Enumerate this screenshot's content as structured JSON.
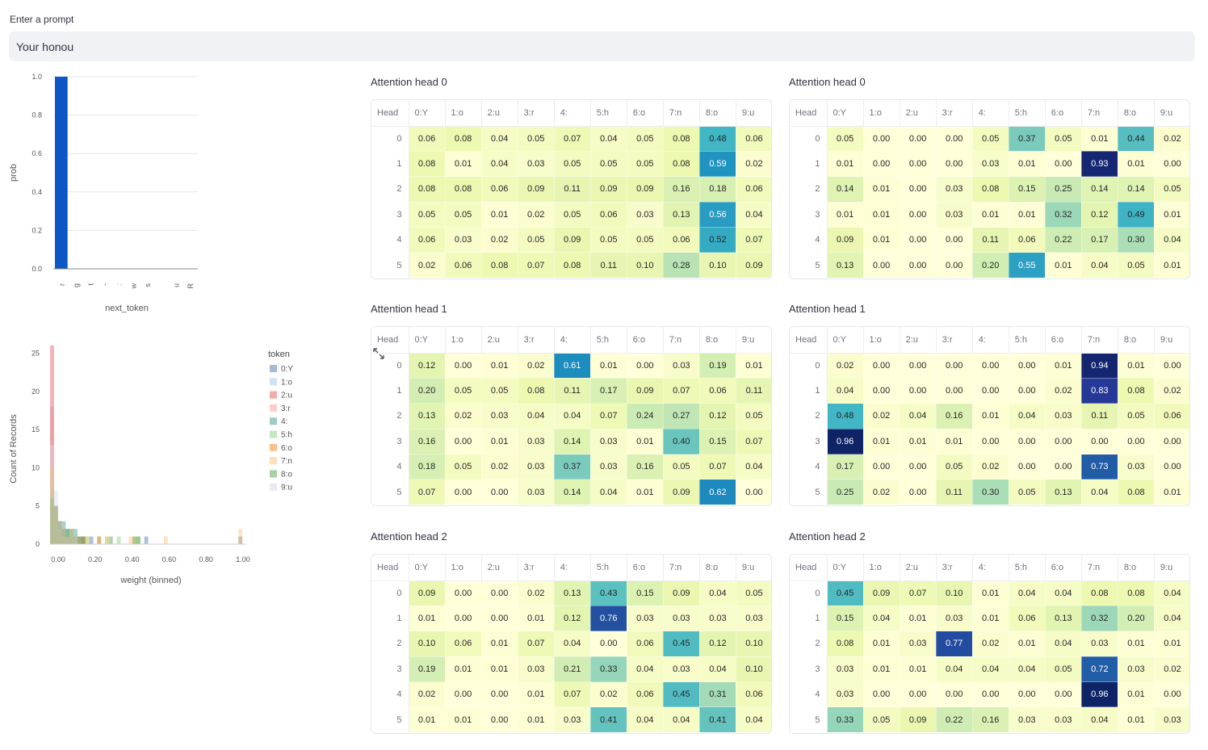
{
  "prompt": {
    "label": "Enter a prompt",
    "value": "Your honou",
    "placeholder": ""
  },
  "bar_chart": {
    "type": "bar",
    "ylabel": "prob",
    "xlabel": "next_token",
    "ylim": [
      0,
      1
    ],
    "yticks": [
      "0.0",
      "0.2",
      "0.4",
      "0.6",
      "0.8",
      "1.0"
    ],
    "categories": [
      "r",
      "g",
      "t",
      "-",
      ":",
      "w",
      "s",
      " ",
      "u",
      "R"
    ],
    "values": [
      1.0,
      0,
      0,
      0,
      0,
      0,
      0,
      0,
      0,
      0
    ],
    "color": "#0b57c6"
  },
  "hist_chart": {
    "type": "bar",
    "xlabel": "weight (binned)",
    "ylabel": "Count of Records",
    "legend_title": "token",
    "legend_placement": "right",
    "xticks": [
      "0.00",
      "0.20",
      "0.40",
      "0.60",
      "0.80",
      "1.00"
    ],
    "yticks": [
      "0",
      "5",
      "10",
      "15",
      "20",
      "25"
    ],
    "ylim": [
      0,
      26
    ],
    "tokens": [
      "0:Y",
      "1:o",
      "2:u",
      "3:r",
      "4:",
      "5:h",
      "6:o",
      "7:n",
      "8:o",
      "9:u"
    ],
    "colors": [
      "#4c78a8",
      "#9ecae9",
      "#e45756",
      "#ff9d98",
      "#439894",
      "#88d27a",
      "#f58518",
      "#ffbf79",
      "#54a24b",
      "#d6d6e6"
    ],
    "series": [
      {
        "name": "0:Y",
        "values": [
          8,
          4,
          3,
          2,
          1,
          1,
          0,
          0,
          1,
          0,
          1,
          0,
          0,
          0,
          0,
          0,
          0,
          0,
          0,
          0,
          0,
          0,
          0,
          0,
          1,
          0,
          0,
          0,
          0,
          0,
          0,
          0,
          0,
          0,
          0,
          0,
          0,
          0,
          0,
          0,
          0,
          0,
          0,
          0,
          0,
          0,
          0,
          0,
          1,
          0
        ]
      },
      {
        "name": "1:o",
        "values": [
          18,
          2,
          2,
          1,
          1,
          0,
          0,
          0,
          0,
          0,
          0,
          0,
          0,
          0,
          0,
          0,
          0,
          0,
          0,
          0,
          0,
          0,
          0,
          0,
          0,
          0,
          0,
          0,
          0,
          0,
          0,
          0,
          0,
          0,
          0,
          0,
          0,
          0,
          0,
          0,
          0,
          0,
          0,
          0,
          0,
          0,
          0,
          0,
          0,
          0
        ]
      },
      {
        "name": "2:u",
        "values": [
          26,
          3,
          1,
          0,
          0,
          0,
          0,
          0,
          0,
          0,
          0,
          0,
          0,
          0,
          0,
          0,
          0,
          0,
          0,
          0,
          0,
          0,
          0,
          0,
          0,
          0,
          0,
          0,
          0,
          0,
          0,
          0,
          0,
          0,
          0,
          0,
          0,
          0,
          0,
          0,
          0,
          0,
          0,
          0,
          0,
          0,
          0,
          0,
          0,
          0
        ]
      },
      {
        "name": "3:r",
        "values": [
          17,
          4,
          3,
          2,
          1,
          1,
          0,
          1,
          0,
          0,
          0,
          0,
          0,
          0,
          0,
          0,
          0,
          0,
          0,
          0,
          0,
          0,
          0,
          0,
          0,
          0,
          0,
          0,
          0,
          0,
          0,
          0,
          0,
          0,
          0,
          0,
          0,
          0,
          0,
          0,
          0,
          0,
          0,
          0,
          0,
          0,
          0,
          0,
          0,
          0
        ]
      },
      {
        "name": "4:",
        "values": [
          7,
          5,
          2,
          3,
          2,
          1,
          2,
          1,
          0,
          0,
          0,
          0,
          1,
          0,
          0,
          0,
          0,
          0,
          0,
          0,
          0,
          0,
          0,
          0,
          0,
          0,
          0,
          0,
          0,
          0,
          0,
          0,
          0,
          0,
          0,
          0,
          0,
          0,
          0,
          0,
          0,
          0,
          0,
          0,
          0,
          0,
          0,
          0,
          0,
          0
        ]
      },
      {
        "name": "5:h",
        "values": [
          9,
          4,
          3,
          1,
          1,
          1,
          0,
          0,
          0,
          1,
          0,
          0,
          0,
          0,
          1,
          0,
          0,
          1,
          0,
          0,
          0,
          0,
          1,
          0,
          0,
          0,
          0,
          0,
          0,
          0,
          0,
          0,
          0,
          0,
          0,
          0,
          0,
          0,
          0,
          0,
          0,
          0,
          0,
          0,
          0,
          0,
          0,
          0,
          0,
          0
        ]
      },
      {
        "name": "6:o",
        "values": [
          10,
          5,
          3,
          2,
          1,
          1,
          1,
          0,
          1,
          0,
          0,
          0,
          1,
          0,
          0,
          0,
          0,
          0,
          0,
          0,
          0,
          0,
          0,
          0,
          0,
          0,
          0,
          0,
          0,
          0,
          0,
          0,
          0,
          0,
          0,
          0,
          0,
          0,
          0,
          0,
          0,
          0,
          0,
          0,
          0,
          0,
          0,
          0,
          0,
          0
        ]
      },
      {
        "name": "7:n",
        "values": [
          10,
          4,
          2,
          1,
          1,
          2,
          1,
          1,
          0,
          1,
          0,
          0,
          1,
          0,
          1,
          0,
          0,
          0,
          0,
          0,
          1,
          1,
          0,
          0,
          0,
          0,
          0,
          0,
          0,
          1,
          0,
          0,
          0,
          0,
          0,
          0,
          0,
          0,
          0,
          0,
          0,
          0,
          0,
          0,
          0,
          0,
          0,
          0,
          2,
          0
        ]
      },
      {
        "name": "8:o",
        "values": [
          6,
          5,
          3,
          2,
          2,
          2,
          1,
          1,
          1,
          0,
          0,
          0,
          0,
          0,
          0,
          1,
          0,
          0,
          0,
          0,
          0,
          1,
          1,
          0,
          0,
          0,
          0,
          0,
          0,
          0,
          0,
          0,
          0,
          0,
          0,
          0,
          0,
          0,
          0,
          0,
          0,
          0,
          0,
          0,
          0,
          0,
          0,
          0,
          0,
          0
        ]
      },
      {
        "name": "9:u",
        "values": [
          13,
          7,
          3,
          2,
          1,
          1,
          1,
          0,
          0,
          0,
          0,
          0,
          0,
          0,
          0,
          0,
          0,
          0,
          0,
          0,
          0,
          0,
          0,
          0,
          0,
          0,
          0,
          0,
          0,
          0,
          0,
          0,
          0,
          0,
          0,
          0,
          0,
          0,
          0,
          0,
          0,
          0,
          0,
          0,
          0,
          0,
          0,
          0,
          0,
          0
        ]
      }
    ]
  },
  "columns": [
    "Head",
    "0:Y",
    "1:o",
    "2:u",
    "3:r",
    "4:",
    "5:h",
    "6:o",
    "7:n",
    "8:o",
    "9:u"
  ],
  "left_panels": [
    {
      "title": "Attention head 0",
      "rows": [
        [
          "0.06",
          "0.08",
          "0.04",
          "0.05",
          "0.07",
          "0.04",
          "0.05",
          "0.08",
          "0.48",
          "0.06"
        ],
        [
          "0.08",
          "0.01",
          "0.04",
          "0.03",
          "0.05",
          "0.05",
          "0.05",
          "0.08",
          "0.59",
          "0.02"
        ],
        [
          "0.08",
          "0.08",
          "0.06",
          "0.09",
          "0.11",
          "0.09",
          "0.09",
          "0.16",
          "0.18",
          "0.06"
        ],
        [
          "0.05",
          "0.05",
          "0.01",
          "0.02",
          "0.05",
          "0.06",
          "0.03",
          "0.13",
          "0.56",
          "0.04"
        ],
        [
          "0.06",
          "0.03",
          "0.02",
          "0.05",
          "0.09",
          "0.05",
          "0.05",
          "0.06",
          "0.52",
          "0.07"
        ],
        [
          "0.02",
          "0.06",
          "0.08",
          "0.07",
          "0.08",
          "0.11",
          "0.10",
          "0.28",
          "0.10",
          "0.09"
        ]
      ]
    },
    {
      "title": "Attention head 1",
      "rows": [
        [
          "0.12",
          "0.00",
          "0.01",
          "0.02",
          "0.61",
          "0.01",
          "0.00",
          "0.03",
          "0.19",
          "0.01"
        ],
        [
          "0.20",
          "0.05",
          "0.05",
          "0.08",
          "0.11",
          "0.17",
          "0.09",
          "0.07",
          "0.06",
          "0.11"
        ],
        [
          "0.13",
          "0.02",
          "0.03",
          "0.04",
          "0.04",
          "0.07",
          "0.24",
          "0.27",
          "0.12",
          "0.05"
        ],
        [
          "0.16",
          "0.00",
          "0.01",
          "0.03",
          "0.14",
          "0.03",
          "0.01",
          "0.40",
          "0.15",
          "0.07"
        ],
        [
          "0.18",
          "0.05",
          "0.02",
          "0.03",
          "0.37",
          "0.03",
          "0.16",
          "0.05",
          "0.07",
          "0.04"
        ],
        [
          "0.07",
          "0.00",
          "0.00",
          "0.03",
          "0.14",
          "0.04",
          "0.01",
          "0.09",
          "0.62",
          "0.00"
        ]
      ]
    },
    {
      "title": "Attention head 2",
      "rows": [
        [
          "0.09",
          "0.00",
          "0.00",
          "0.02",
          "0.13",
          "0.43",
          "0.15",
          "0.09",
          "0.04",
          "0.05"
        ],
        [
          "0.01",
          "0.00",
          "0.00",
          "0.01",
          "0.12",
          "0.76",
          "0.03",
          "0.03",
          "0.03",
          "0.03"
        ],
        [
          "0.10",
          "0.06",
          "0.01",
          "0.07",
          "0.04",
          "0.00",
          "0.06",
          "0.45",
          "0.12",
          "0.10"
        ],
        [
          "0.19",
          "0.01",
          "0.01",
          "0.03",
          "0.21",
          "0.33",
          "0.04",
          "0.03",
          "0.04",
          "0.10"
        ],
        [
          "0.02",
          "0.00",
          "0.00",
          "0.01",
          "0.07",
          "0.02",
          "0.06",
          "0.45",
          "0.31",
          "0.06"
        ],
        [
          "0.01",
          "0.01",
          "0.00",
          "0.01",
          "0.03",
          "0.41",
          "0.04",
          "0.04",
          "0.41",
          "0.04"
        ]
      ]
    }
  ],
  "right_panels": [
    {
      "title": "Attention head 0",
      "rows": [
        [
          "0.05",
          "0.00",
          "0.00",
          "0.00",
          "0.05",
          "0.37",
          "0.05",
          "0.01",
          "0.44",
          "0.02"
        ],
        [
          "0.01",
          "0.00",
          "0.00",
          "0.00",
          "0.03",
          "0.01",
          "0.00",
          "0.93",
          "0.01",
          "0.00"
        ],
        [
          "0.14",
          "0.01",
          "0.00",
          "0.03",
          "0.08",
          "0.15",
          "0.25",
          "0.14",
          "0.14",
          "0.05"
        ],
        [
          "0.01",
          "0.01",
          "0.00",
          "0.03",
          "0.01",
          "0.01",
          "0.32",
          "0.12",
          "0.49",
          "0.01"
        ],
        [
          "0.09",
          "0.01",
          "0.00",
          "0.00",
          "0.11",
          "0.06",
          "0.22",
          "0.17",
          "0.30",
          "0.04"
        ],
        [
          "0.13",
          "0.00",
          "0.00",
          "0.00",
          "0.20",
          "0.55",
          "0.01",
          "0.04",
          "0.05",
          "0.01"
        ]
      ]
    },
    {
      "title": "Attention head 1",
      "rows": [
        [
          "0.02",
          "0.00",
          "0.00",
          "0.00",
          "0.00",
          "0.00",
          "0.01",
          "0.94",
          "0.01",
          "0.00"
        ],
        [
          "0.04",
          "0.00",
          "0.00",
          "0.00",
          "0.00",
          "0.00",
          "0.02",
          "0.83",
          "0.08",
          "0.02"
        ],
        [
          "0.48",
          "0.02",
          "0.04",
          "0.16",
          "0.01",
          "0.04",
          "0.03",
          "0.11",
          "0.05",
          "0.06"
        ],
        [
          "0.96",
          "0.01",
          "0.01",
          "0.01",
          "0.00",
          "0.00",
          "0.00",
          "0.00",
          "0.00",
          "0.00"
        ],
        [
          "0.17",
          "0.00",
          "0.00",
          "0.05",
          "0.02",
          "0.00",
          "0.00",
          "0.73",
          "0.03",
          "0.00"
        ],
        [
          "0.25",
          "0.02",
          "0.00",
          "0.11",
          "0.30",
          "0.05",
          "0.13",
          "0.04",
          "0.08",
          "0.01"
        ]
      ]
    },
    {
      "title": "Attention head 2",
      "rows": [
        [
          "0.45",
          "0.09",
          "0.07",
          "0.10",
          "0.01",
          "0.04",
          "0.04",
          "0.08",
          "0.08",
          "0.04"
        ],
        [
          "0.15",
          "0.04",
          "0.01",
          "0.03",
          "0.01",
          "0.06",
          "0.13",
          "0.32",
          "0.20",
          "0.04"
        ],
        [
          "0.08",
          "0.01",
          "0.03",
          "0.77",
          "0.02",
          "0.01",
          "0.04",
          "0.03",
          "0.01",
          "0.01"
        ],
        [
          "0.03",
          "0.01",
          "0.01",
          "0.04",
          "0.04",
          "0.04",
          "0.05",
          "0.72",
          "0.03",
          "0.02"
        ],
        [
          "0.03",
          "0.00",
          "0.00",
          "0.00",
          "0.00",
          "0.00",
          "0.00",
          "0.96",
          "0.01",
          "0.00"
        ],
        [
          "0.33",
          "0.05",
          "0.09",
          "0.22",
          "0.16",
          "0.03",
          "0.03",
          "0.04",
          "0.01",
          "0.03"
        ]
      ]
    }
  ]
}
